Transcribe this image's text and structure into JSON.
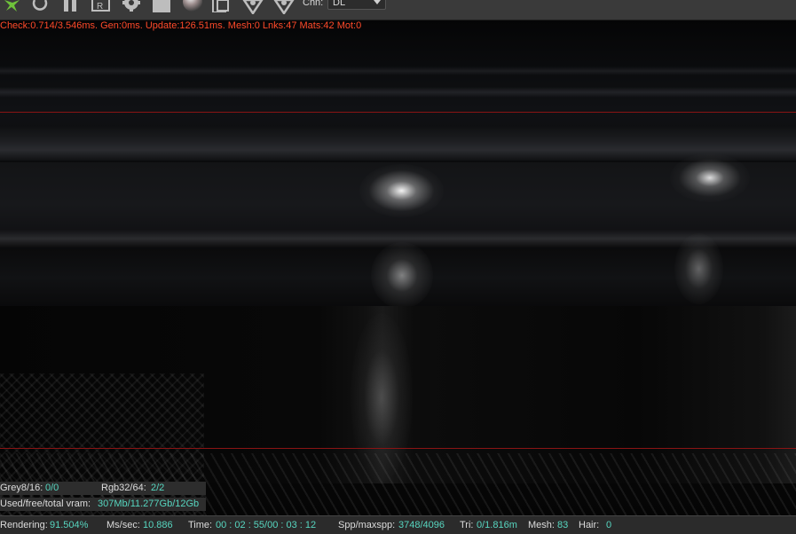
{
  "toolbar": {
    "icons": [
      "octane-logo-icon",
      "restart-icon",
      "pause-icon",
      "region-render-icon",
      "settings-icon",
      "stop-icon",
      "material-ball-icon",
      "clipboard-icon",
      "pick-focus-icon",
      "pick-material-icon"
    ],
    "channel_label": "Chn:",
    "channel_value": "DL"
  },
  "debug": {
    "stats": "Check:0.714/3.546ms. Gen:0ms. Update:126.51ms. Mesh:0 Lnks:47 Mats:42 Mot:0"
  },
  "textures": {
    "grey_label": "Grey8/16:",
    "grey_value": "0/0",
    "rgb_label": "Rgb32/64:",
    "rgb_value": "2/2"
  },
  "vram": {
    "label": "Used/free/total vram:",
    "value": "307Mb/11.277Gb/12Gb"
  },
  "status": {
    "rendering_label": "Rendering:",
    "rendering_value": "91.504%",
    "ms_label": "Ms/sec:",
    "ms_value": "10.886",
    "time_label": "Time:",
    "time_value": "00 : 02 : 55/00 : 03 : 12",
    "spp_label": "Spp/maxspp:",
    "spp_value": "3748/4096",
    "tri_label": "Tri:",
    "tri_value": "0/1.816m",
    "mesh_label": "Mesh:",
    "mesh_value": "83",
    "hair_label": "Hair:",
    "hair_value": "0"
  },
  "colors": {
    "accent_value": "#57d6c0",
    "debug_text": "#ff4a2a",
    "region_line": "#8a1414"
  }
}
